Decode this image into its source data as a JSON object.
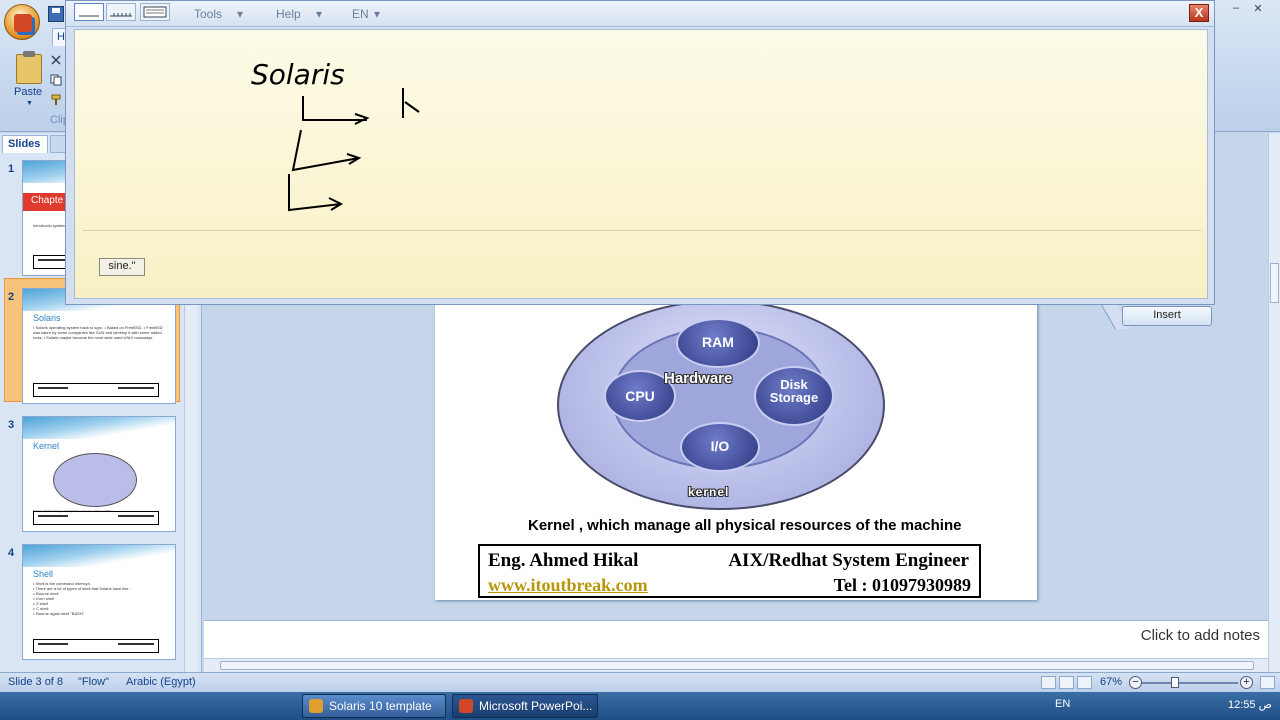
{
  "ribbon": {
    "home_tab": "H",
    "paste_label": "Paste",
    "clipboard_label": "Clipb"
  },
  "math_input": {
    "menus": [
      "Tools",
      "Help",
      "EN"
    ],
    "close_label": "X",
    "recognized_word": "sine.\"",
    "insert_label": "Insert",
    "ink_text": "Solaris"
  },
  "slides_panel": {
    "tab_label": "Slides",
    "slides": [
      {
        "num": "1",
        "title": "Chapte",
        "body": "Introductio\nsystem"
      },
      {
        "num": "2",
        "title": "Solaris",
        "body": "• Solaris operating system back to sgro.\n• Based on FreeBSD.\n• FreeBSD was taken by some companies like SUN and develop it with some added tools.\n• Solaris maybe become the most wide used UNIX nowadays."
      },
      {
        "num": "3",
        "title": "Kernel",
        "body": "Kernel, which manage all physical resources of the machine"
      },
      {
        "num": "4",
        "title": "Shell",
        "body": "• Shell is the command Interrupt.\n• There are a lot of types of shell that Solaris have like :\n  ▹ Bourne shell\n  ▹ Korn shell\n  ▹ Z shell\n  ▹ C shell\n  ▹ Bourne again shell \"BASH\""
      }
    ]
  },
  "slide": {
    "hardware_label": "Hardware",
    "nodes": [
      "RAM",
      "CPU",
      "Disk Storage",
      "I/O"
    ],
    "kernel_label": "kernel",
    "caption": "Kernel , which manage all physical resources of the machine",
    "footer": {
      "name": "Eng. Ahmed Hikal",
      "role": "AIX/Redhat System Engineer",
      "site": "www.itoutbreak.com",
      "tel": "Tel : 01097930989"
    }
  },
  "notes_placeholder": "Click to add notes",
  "status": {
    "slide_info": "Slide 3 of 8",
    "theme": "\"Flow\"",
    "language": "Arabic (Egypt)",
    "zoom": "67%"
  },
  "taskbar": {
    "items": [
      "Solaris 10 template -...",
      "Microsoft PowerPoi..."
    ],
    "lang": "EN",
    "clock": "12:55 ص"
  },
  "colors": {
    "accent": "#15428b",
    "writing_area": "#f8f0c4",
    "node": "#39458f"
  }
}
